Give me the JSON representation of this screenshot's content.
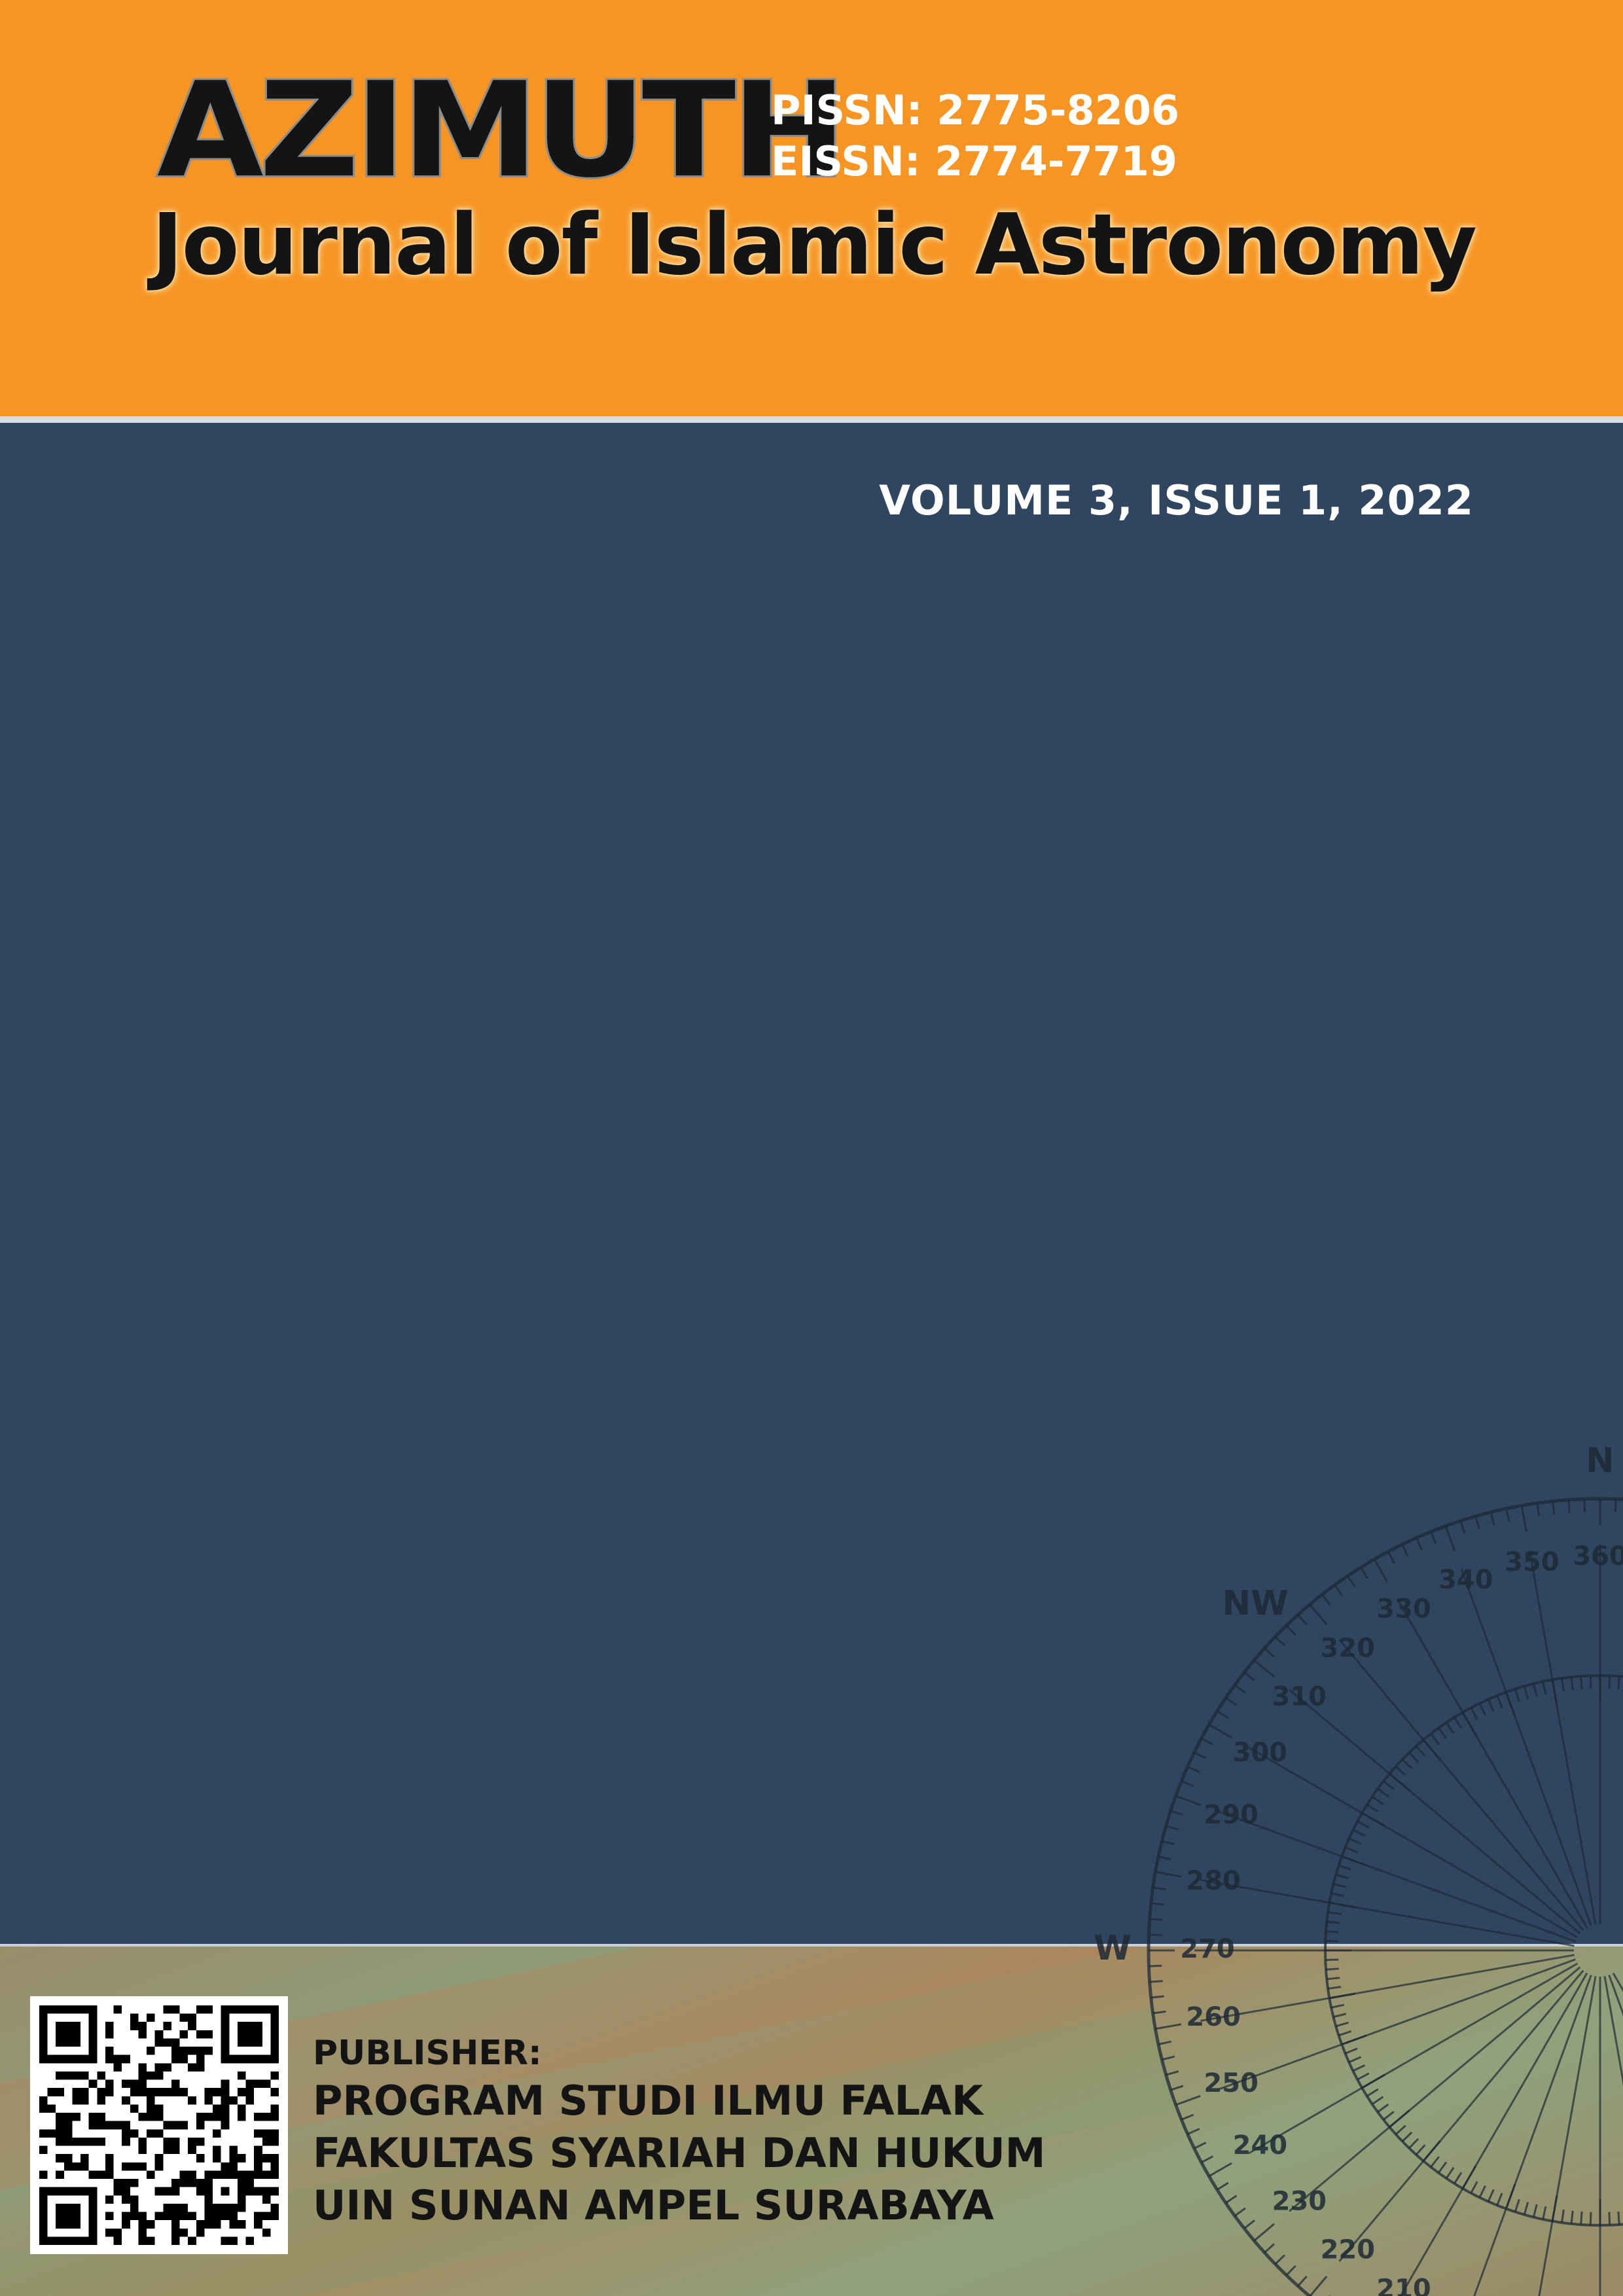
{
  "header": {
    "brand": "AZIMUTH",
    "pissn": "PISSN: 2775-8206",
    "eissn": "EISSN: 2774-7719",
    "subtitle": "Journal of Islamic Astronomy"
  },
  "volume_label": "VOLUME 3,  ISSUE 1, 2022",
  "publisher": {
    "label": "PUBLISHER:",
    "lines": [
      "PROGRAM STUDI ILMU FALAK",
      "FAKULTAS SYARIAH DAN HUKUM",
      "UIN SUNAN AMPEL SURABAYA"
    ]
  },
  "compass": {
    "directions": [
      "N",
      "NW",
      "W"
    ],
    "degree_labels": [
      "360",
      "350",
      "340",
      "330",
      "320",
      "310",
      "300",
      "290",
      "280",
      "270",
      "260",
      "250",
      "240",
      "230",
      "220",
      "210"
    ]
  },
  "colors": {
    "header": "#f69524",
    "body": "#2f4560",
    "text_light": "#ffffff",
    "text_dark": "#141414"
  }
}
